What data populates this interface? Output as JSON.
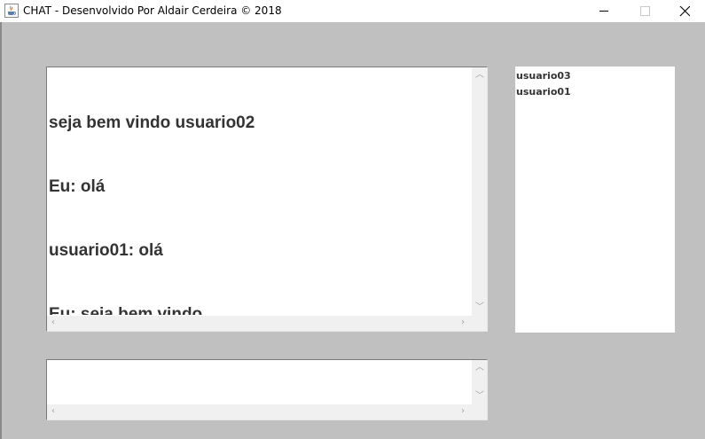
{
  "window": {
    "title": "CHAT  - Desenvolvido Por Aldair Cerdeira © 2018",
    "icon": "java-cup-icon",
    "controls": [
      "minimize-icon",
      "maximize-icon",
      "close-icon"
    ]
  },
  "chat": {
    "messages": [
      "seja bem vindo usuario02",
      "Eu: olá",
      "usuario01: olá",
      "Eu: seja bem vindo"
    ]
  },
  "users": {
    "items": [
      "usuario03",
      "usuario01"
    ]
  },
  "message_input": {
    "value": ""
  },
  "colors": {
    "background": "#c0c0c0",
    "text": "#333333",
    "scrollbar": "#f0f0f0"
  }
}
